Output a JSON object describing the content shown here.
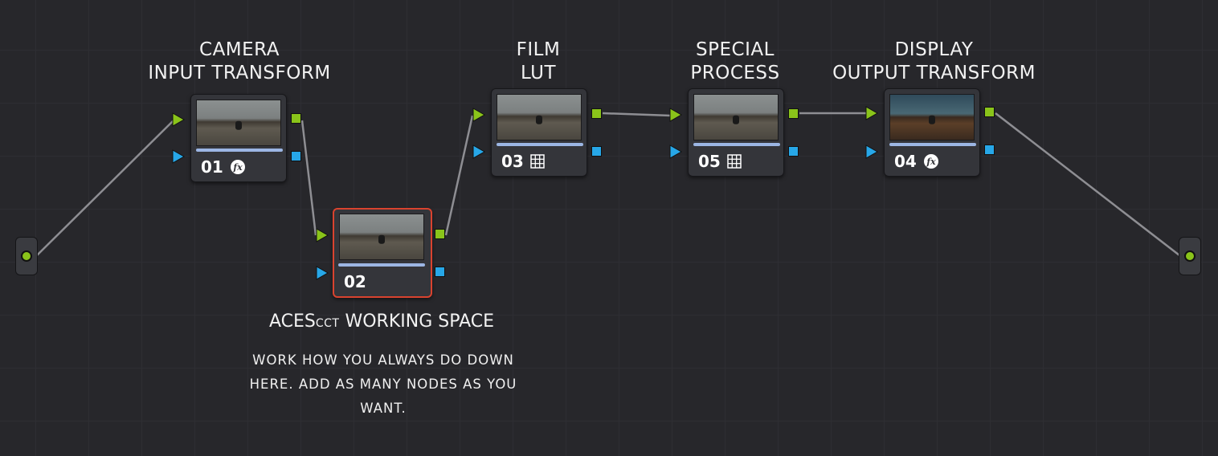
{
  "labels": {
    "camera": [
      "CAMERA",
      "INPUT TRANSFORM"
    ],
    "film": [
      "FILM",
      "LUT"
    ],
    "special": [
      "SPECIAL",
      "PROCESS"
    ],
    "display": [
      "DISPLAY",
      "OUTPUT TRANSFORM"
    ]
  },
  "nodes": [
    {
      "number": "01",
      "icon": "fx-icon"
    },
    {
      "number": "02",
      "icon": ""
    },
    {
      "number": "03",
      "icon": "lut-grid-icon"
    },
    {
      "number": "05",
      "icon": "lut-grid-icon"
    },
    {
      "number": "04",
      "icon": "fx-icon"
    }
  ],
  "working_space": {
    "title_main": "ACES",
    "title_small": "CCT",
    "title_rest": " WORKING SPACE",
    "description": "WORK HOW YOU ALWAYS DO DOWN HERE. ADD AS MANY NODES AS YOU WANT."
  },
  "colors": {
    "background": "#27272b",
    "node": "#34353a",
    "selected_border": "#d9432f",
    "green_port": "#8ac41a",
    "blue_port": "#27a7e8",
    "wire": "#8e8e93"
  }
}
